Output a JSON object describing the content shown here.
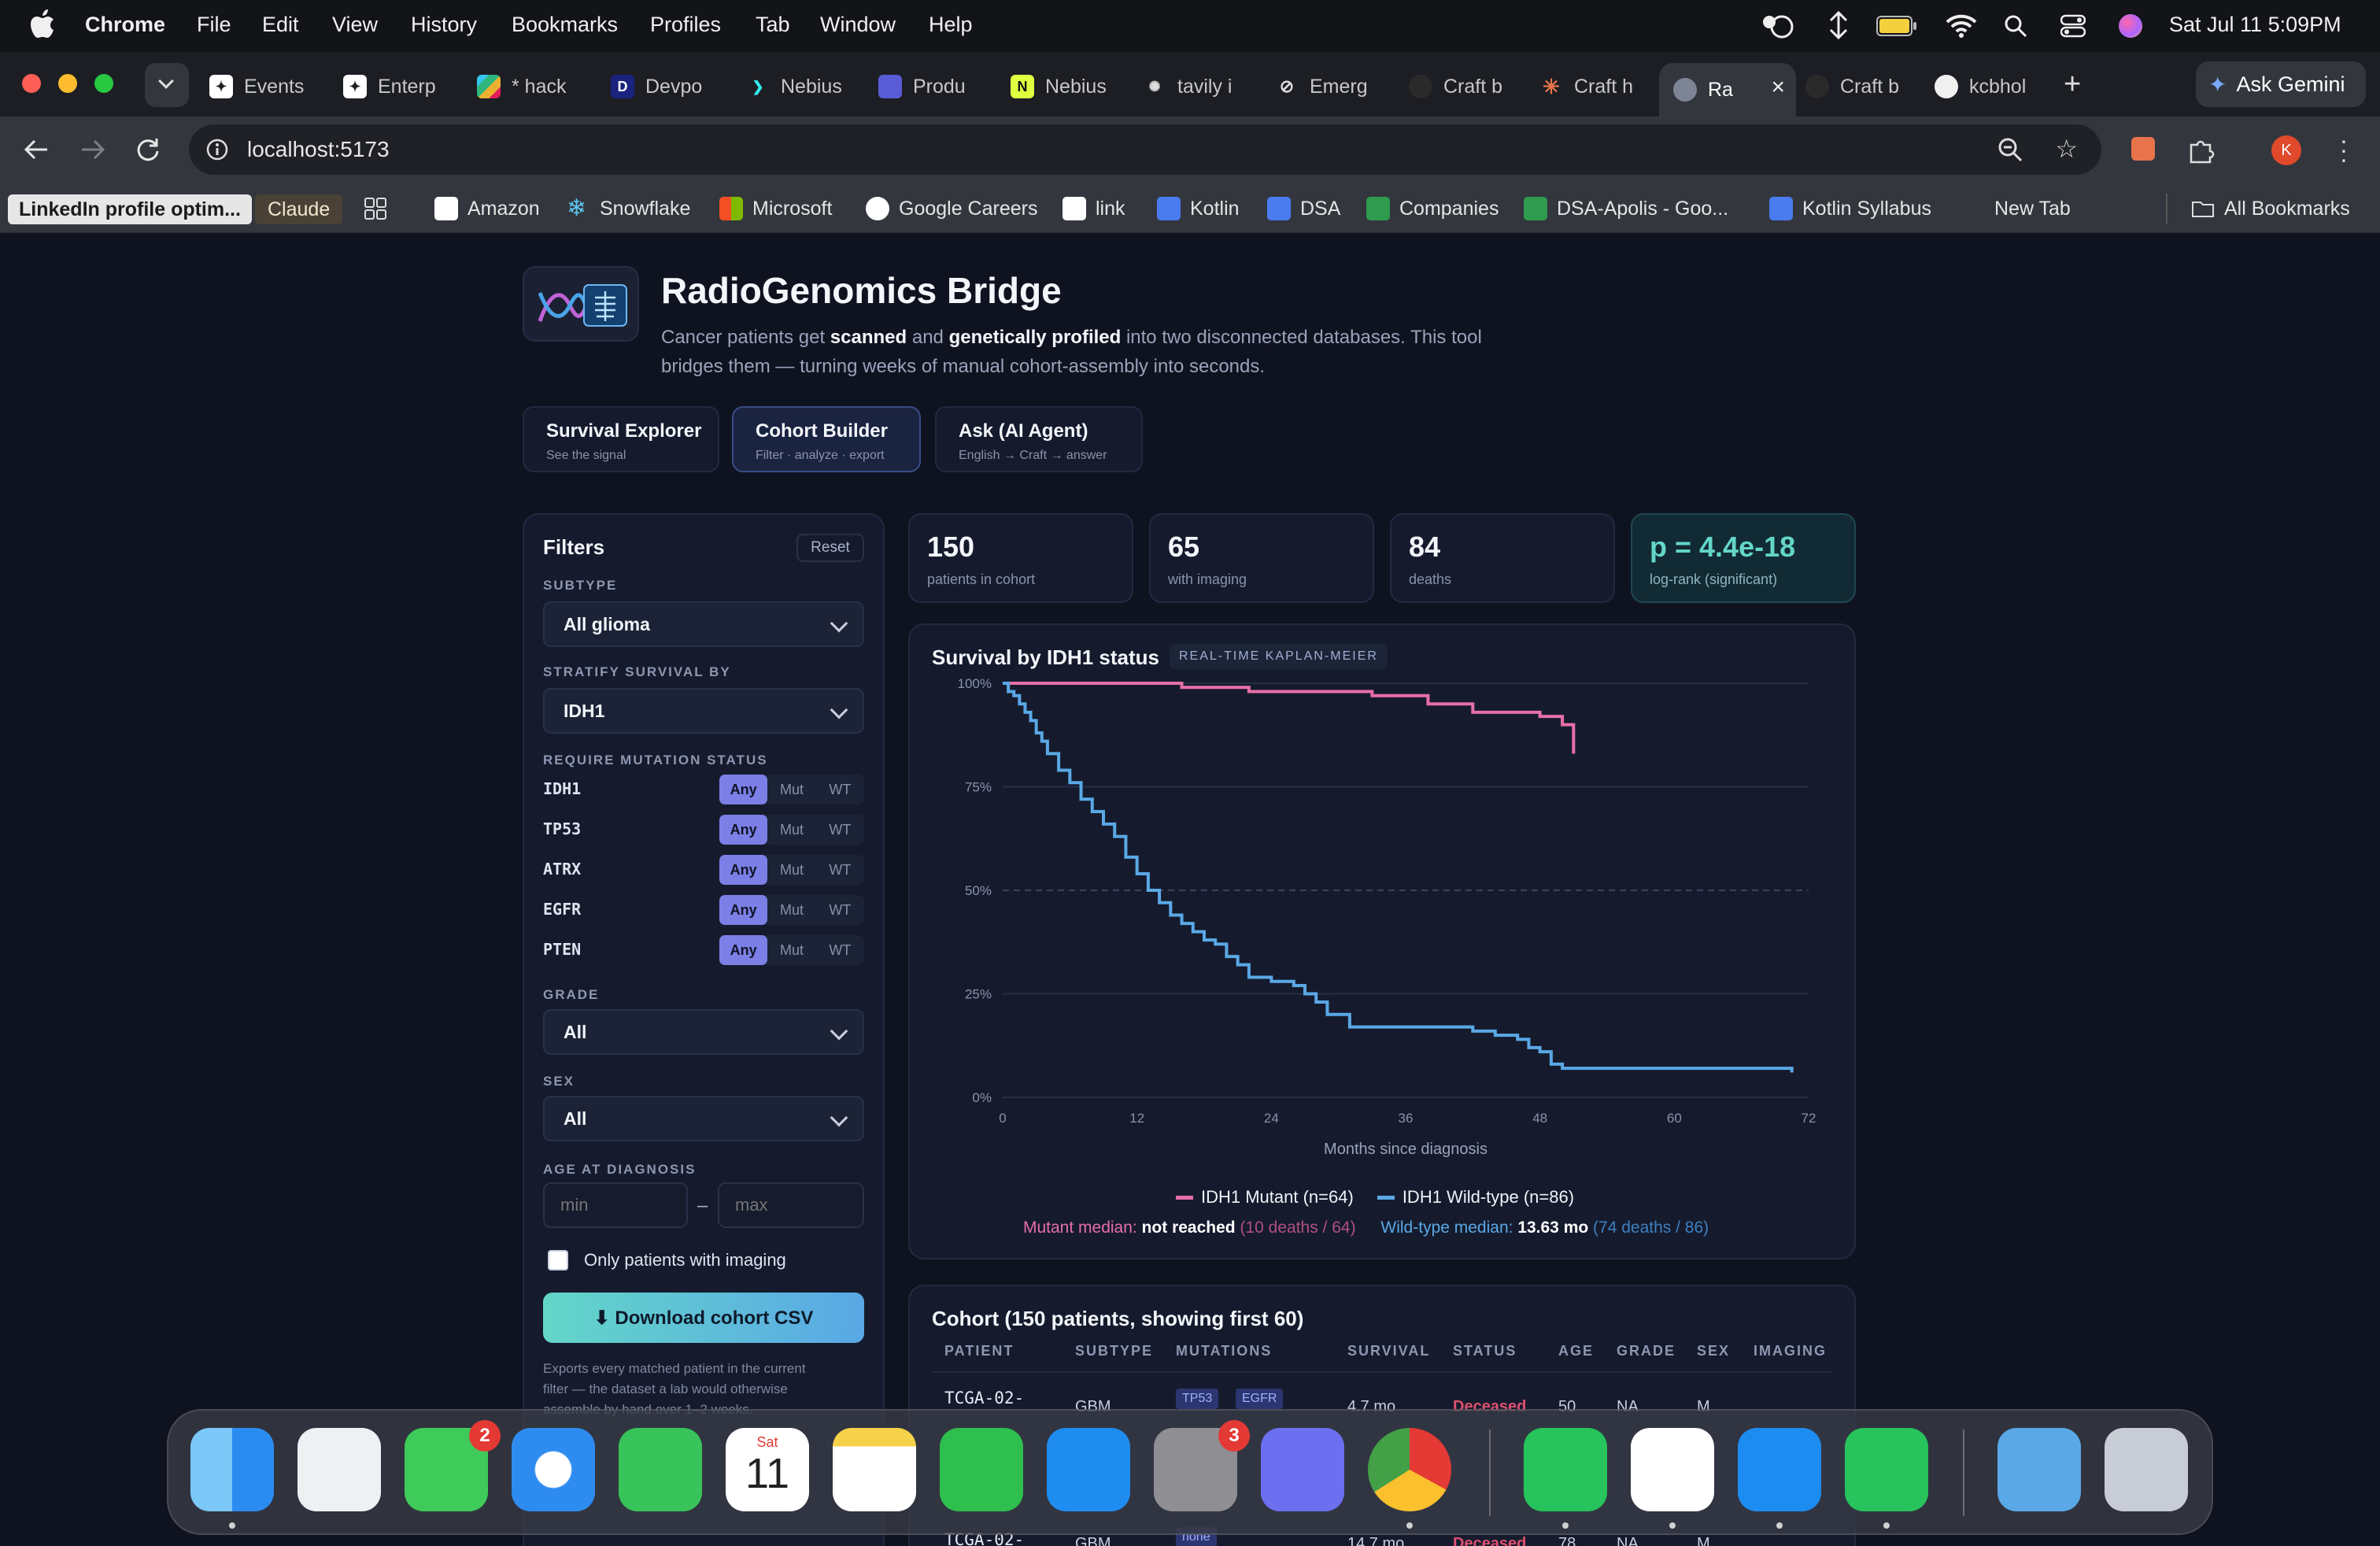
{
  "menubar": {
    "app": "Chrome",
    "menus": [
      "File",
      "Edit",
      "View",
      "History",
      "Bookmarks",
      "Profiles",
      "Tab",
      "Window",
      "Help"
    ],
    "datetime": "Sat Jul 11  5:09PM"
  },
  "tabs": [
    "Events",
    "Enterp",
    "* hack",
    "Devpo",
    "Nebius",
    "Produ",
    "Nebius",
    "tavily i",
    "Emerg",
    "Craft b",
    "Craft h",
    "Ra",
    "Craft b",
    "kcbhol"
  ],
  "ask_gemini": "Ask Gemini",
  "url": "localhost:5173",
  "profile_initial": "K",
  "bookmarks": [
    "LinkedIn profile optim...",
    "Claude",
    "Amazon",
    "Snowflake",
    "Microsoft",
    "Google Careers",
    "link",
    "Kotlin",
    "DSA",
    "Companies",
    "DSA-Apolis - Goo...",
    "Kotlin Syllabus",
    "New Tab",
    "All Bookmarks"
  ],
  "app": {
    "title": "RadioGenomics Bridge",
    "desc_1": "Cancer patients get ",
    "desc_b1": "scanned",
    "desc_2": " and ",
    "desc_b2": "genetically profiled",
    "desc_3": " into two disconnected databases. This tool",
    "desc_line2": "bridges them — turning weeks of manual cohort-assembly into seconds.",
    "nav": [
      {
        "label": "Survival Explorer",
        "sub": "See the signal"
      },
      {
        "label": "Cohort Builder",
        "sub": "Filter · analyze · export"
      },
      {
        "label": "Ask (AI Agent)",
        "sub": "English → Craft → answer"
      }
    ]
  },
  "filters": {
    "title": "Filters",
    "reset": "Reset",
    "subtype_label": "SUBTYPE",
    "subtype_value": "All glioma",
    "stratify_label": "STRATIFY SURVIVAL BY",
    "stratify_value": "IDH1",
    "mutation_label": "REQUIRE MUTATION STATUS",
    "genes": [
      "IDH1",
      "TP53",
      "ATRX",
      "EGFR",
      "PTEN"
    ],
    "seg_options": [
      "Any",
      "Mut",
      "WT"
    ],
    "grade_label": "GRADE",
    "grade_value": "All",
    "sex_label": "SEX",
    "sex_value": "All",
    "age_label": "AGE AT DIAGNOSIS",
    "age_min_placeholder": "min",
    "age_max_placeholder": "max",
    "age_sep": "–",
    "imaging_only": "Only patients with imaging",
    "download": "⬇ Download cohort CSV",
    "export_note_1": "Exports every matched patient in the current",
    "export_note_2": "filter — the dataset a lab would otherwise",
    "export_note_3": "assemble by hand over 1–2 weeks."
  },
  "stats": [
    {
      "value": "150",
      "label": "patients in cohort"
    },
    {
      "value": "65",
      "label": "with imaging"
    },
    {
      "value": "84",
      "label": "deaths"
    },
    {
      "value": "p = 4.4e-18",
      "label": "log-rank (significant)"
    }
  ],
  "chart_title": "Survival by IDH1 status",
  "chart_badge": "REAL-TIME KAPLAN-MEIER",
  "chart_data": {
    "type": "line",
    "xlabel": "Months since diagnosis",
    "ylabel": "",
    "xlim": [
      0,
      72
    ],
    "ylim": [
      0,
      100
    ],
    "xticks": [
      "0",
      "12",
      "24",
      "36",
      "48",
      "60",
      "72"
    ],
    "yticks": [
      "100%",
      "75%",
      "50%",
      "25%",
      "0%"
    ],
    "legend_position": "bottom",
    "series": [
      {
        "name": "IDH1 Mutant (n=64)",
        "color": "#e76fa8",
        "x": [
          0,
          14,
          16,
          20,
          22,
          30,
          33,
          36,
          38,
          40,
          42,
          48,
          50,
          51,
          51
        ],
        "y": [
          100,
          100,
          99,
          99,
          98,
          98,
          97,
          97,
          95,
          95,
          93,
          92,
          90,
          88,
          83
        ]
      },
      {
        "name": "IDH1 Wild-type (n=86)",
        "color": "#5aa8e6",
        "x": [
          0,
          0.5,
          1,
          1.5,
          2,
          2.5,
          3,
          3.5,
          4,
          5,
          6,
          7,
          8,
          9,
          10,
          11,
          12,
          13,
          14,
          15,
          16,
          17,
          18,
          19,
          20,
          21,
          22,
          24,
          26,
          27,
          28,
          29,
          31,
          34,
          38,
          40,
          42,
          44,
          46,
          47,
          48,
          49,
          50,
          52,
          55,
          60,
          65,
          69.5,
          70,
          70.5
        ],
        "y": [
          100,
          98,
          97,
          95,
          93,
          91,
          88,
          86,
          83,
          79,
          76,
          72,
          69,
          66,
          63,
          58,
          54,
          50,
          47,
          44,
          42,
          40,
          38,
          37,
          34,
          32,
          29,
          28,
          27,
          25,
          23,
          20,
          17,
          17,
          17,
          17,
          16,
          15,
          14,
          12,
          11,
          8,
          7,
          7,
          7,
          7,
          7,
          7,
          7,
          6
        ]
      }
    ]
  },
  "legend": [
    {
      "label": "IDH1 Mutant (n=64)",
      "color": "#e76fa8"
    },
    {
      "label": "IDH1 Wild-type (n=86)",
      "color": "#5aa8e6"
    }
  ],
  "medians": {
    "mut_label": "Mutant median: ",
    "mut_value": "not reached",
    "mut_detail": "(10 deaths / 64)",
    "wt_label": "Wild-type median: ",
    "wt_value": "13.63 mo",
    "wt_detail": "(74 deaths / 86)"
  },
  "cohort": {
    "title": "Cohort (150 patients, showing first 60)",
    "columns": [
      "PATIENT",
      "SUBTYPE",
      "MUTATIONS",
      "SURVIVAL",
      "STATUS",
      "AGE",
      "GRADE",
      "SEX",
      "IMAGING"
    ],
    "row1": {
      "patient": "TCGA-02-",
      "subtype": "GBM",
      "muts": [
        "TP53",
        "EGFR"
      ],
      "survival": "4.7 mo",
      "status": "Deceased",
      "age": "50",
      "grade": "NA",
      "sex": "M"
    },
    "row2": {
      "patient": "TCGA-02-",
      "subtype": "GBM",
      "muts": [
        "none"
      ],
      "survival": "14.7 mo",
      "status": "Deceased",
      "age": "78",
      "grade": "NA",
      "sex": "M"
    }
  },
  "dock": {
    "badge_messages": "2",
    "badge_settings": "3",
    "calendar_day": "Sat",
    "calendar_date": "11"
  }
}
